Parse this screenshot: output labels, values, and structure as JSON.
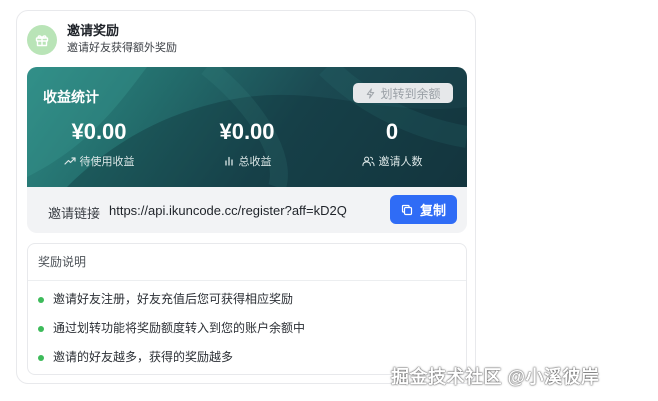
{
  "header": {
    "icon": "gift-icon",
    "title": "邀请奖励",
    "subtitle": "邀请好友获得额外奖励"
  },
  "stats": {
    "title": "收益统计",
    "transfer_button": {
      "icon": "lightning-icon",
      "label": "划转到余额"
    },
    "items": [
      {
        "value": "¥0.00",
        "icon": "trend-up-icon",
        "label": "待使用收益"
      },
      {
        "value": "¥0.00",
        "icon": "bar-chart-icon",
        "label": "总收益"
      },
      {
        "value": "0",
        "icon": "users-icon",
        "label": "邀请人数"
      }
    ]
  },
  "invite": {
    "label": "邀请链接",
    "url": "https://api.ikuncode.cc/register?aff=kD2Q",
    "copy_button": {
      "icon": "copy-icon",
      "label": "复制"
    }
  },
  "rules": {
    "title": "奖励说明",
    "items": [
      "邀请好友注册，好友充值后您可获得相应奖励",
      "通过划转功能将奖励额度转入到您的账户余额中",
      "邀请的好友越多，获得的奖励越多"
    ]
  },
  "watermark": "掘金技术社区 @小溪彼岸",
  "colors": {
    "accent_blue": "#2f6cf6",
    "bullet_green": "#3dbb5a",
    "gift_badge": "#b9e4b7",
    "stats_gradient_start": "#2e8a84",
    "stats_gradient_end": "#163942"
  }
}
